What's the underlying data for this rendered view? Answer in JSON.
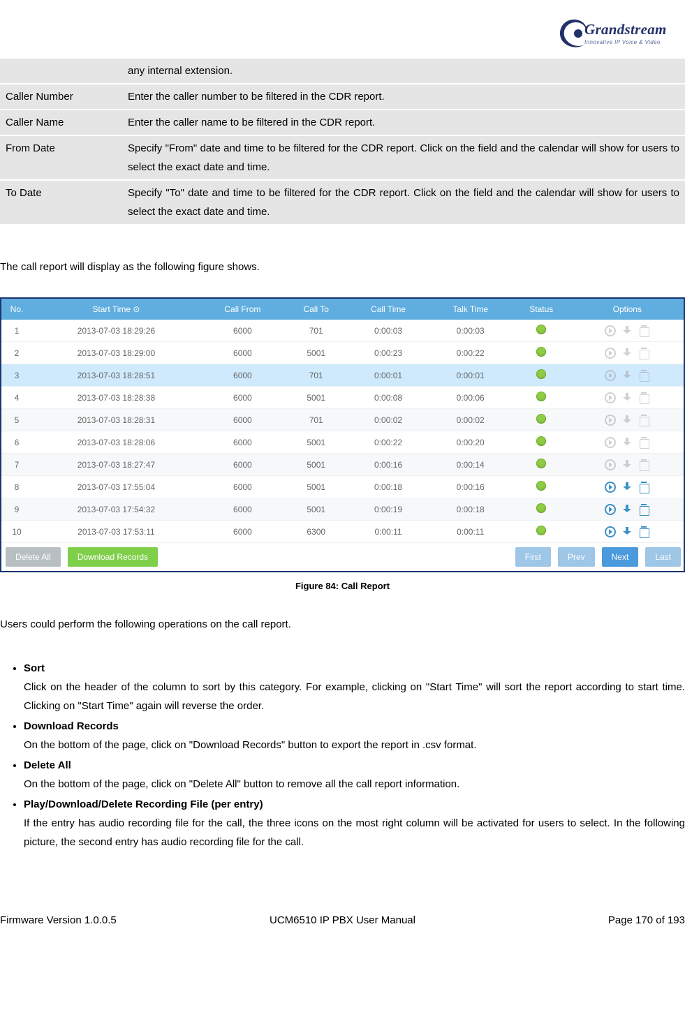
{
  "logo": {
    "brand": "Grandstream",
    "tagline": "Innovative IP Voice & Video"
  },
  "filter_table": [
    {
      "label": "",
      "desc": "any internal extension."
    },
    {
      "label": "Caller Number",
      "desc": "Enter the caller number to be filtered in the CDR report."
    },
    {
      "label": "Caller Name",
      "desc": "Enter the caller name to be filtered in the CDR report."
    },
    {
      "label": "From Date",
      "desc": "Specify \"From\" date and time to be filtered for the CDR report. Click on the field and the calendar will show for users to select the exact date and time."
    },
    {
      "label": "To Date",
      "desc": "Specify \"To\" date and time to be filtered for the CDR report. Click on the field and the calendar will show for users to select the exact date and time."
    }
  ],
  "intro": "The call report will display as the following figure shows.",
  "chart_data": {
    "type": "table",
    "columns": [
      "No.",
      "Start Time ⊙",
      "Call From",
      "Call To",
      "Call Time",
      "Talk Time",
      "Status",
      "Options"
    ],
    "rows": [
      {
        "no": "1",
        "start": "2013-07-03 18:29:26",
        "from": "6000",
        "to": "701",
        "call": "0:00:03",
        "talk": "0:00:03",
        "highlight": false,
        "alt": false,
        "active": false
      },
      {
        "no": "2",
        "start": "2013-07-03 18:29:00",
        "from": "6000",
        "to": "5001",
        "call": "0:00:23",
        "talk": "0:00:22",
        "highlight": false,
        "alt": false,
        "active": false
      },
      {
        "no": "3",
        "start": "2013-07-03 18:28:51",
        "from": "6000",
        "to": "701",
        "call": "0:00:01",
        "talk": "0:00:01",
        "highlight": true,
        "alt": false,
        "active": false
      },
      {
        "no": "4",
        "start": "2013-07-03 18:28:38",
        "from": "6000",
        "to": "5001",
        "call": "0:00:08",
        "talk": "0:00:06",
        "highlight": false,
        "alt": false,
        "active": false
      },
      {
        "no": "5",
        "start": "2013-07-03 18:28:31",
        "from": "6000",
        "to": "701",
        "call": "0:00:02",
        "talk": "0:00:02",
        "highlight": false,
        "alt": true,
        "active": false
      },
      {
        "no": "6",
        "start": "2013-07-03 18:28:06",
        "from": "6000",
        "to": "5001",
        "call": "0:00:22",
        "talk": "0:00:20",
        "highlight": false,
        "alt": false,
        "active": false
      },
      {
        "no": "7",
        "start": "2013-07-03 18:27:47",
        "from": "6000",
        "to": "5001",
        "call": "0:00:16",
        "talk": "0:00:14",
        "highlight": false,
        "alt": true,
        "active": false
      },
      {
        "no": "8",
        "start": "2013-07-03 17:55:04",
        "from": "6000",
        "to": "5001",
        "call": "0:00:18",
        "talk": "0:00:16",
        "highlight": false,
        "alt": false,
        "active": true
      },
      {
        "no": "9",
        "start": "2013-07-03 17:54:32",
        "from": "6000",
        "to": "5001",
        "call": "0:00:19",
        "talk": "0:00:18",
        "highlight": false,
        "alt": true,
        "active": true
      },
      {
        "no": "10",
        "start": "2013-07-03 17:53:11",
        "from": "6000",
        "to": "6300",
        "call": "0:00:11",
        "talk": "0:00:11",
        "highlight": false,
        "alt": false,
        "active": true
      }
    ],
    "footer_buttons": {
      "delete_all": "Delete All",
      "download": "Download Records",
      "first": "First",
      "prev": "Prev",
      "next": "Next",
      "last": "Last"
    }
  },
  "caption": "Figure 84: Call Report",
  "ops_intro": "Users could perform the following operations on the call report.",
  "ops": [
    {
      "title": "Sort",
      "body": "Click on the header of the column to sort by this category. For example, clicking on \"Start Time\" will sort the report according to start time. Clicking on \"Start Time\" again will reverse the order."
    },
    {
      "title": "Download Records",
      "body": "On the bottom of the page, click on \"Download Records\" button to export the report in .csv format."
    },
    {
      "title": "Delete All",
      "body": "On the bottom of the page, click on \"Delete All\" button to remove all the call report information."
    },
    {
      "title": "Play/Download/Delete Recording File (per entry)",
      "body": "If the entry has audio recording file for the call, the three icons on the most right column will be activated for users to select. In the following picture, the second entry has audio recording file for the call."
    }
  ],
  "footer": {
    "left": "Firmware Version 1.0.0.5",
    "center": "UCM6510 IP PBX User Manual",
    "right": "Page 170 of 193"
  }
}
